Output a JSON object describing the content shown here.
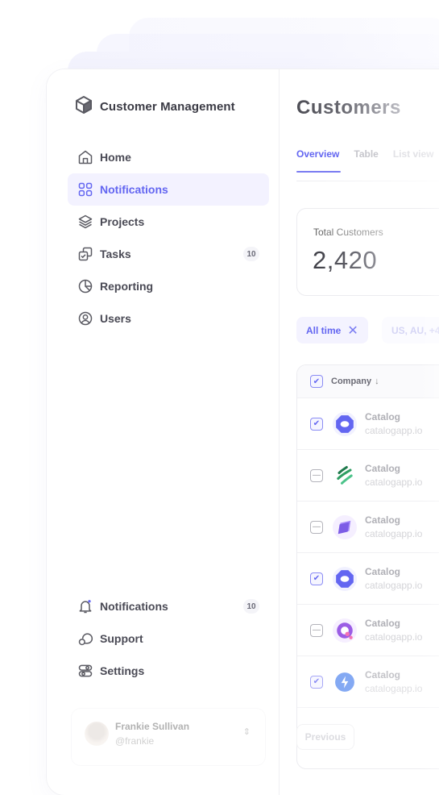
{
  "app": {
    "title": "Customer Management",
    "logo_icon": "cube-icon"
  },
  "sidebar": {
    "items": [
      {
        "label": "Home",
        "icon": "home-icon",
        "active": false
      },
      {
        "label": "Notifications",
        "icon": "grid-icon",
        "active": true
      },
      {
        "label": "Projects",
        "icon": "layers-icon",
        "active": false
      },
      {
        "label": "Tasks",
        "icon": "tasks-icon",
        "active": false,
        "badge": "10"
      },
      {
        "label": "Reporting",
        "icon": "pie-chart-icon",
        "active": false
      },
      {
        "label": "Users",
        "icon": "user-circle-icon",
        "active": false
      }
    ],
    "bottom_items": [
      {
        "label": "Notifications",
        "icon": "bell-icon",
        "badge": "10"
      },
      {
        "label": "Support",
        "icon": "support-icon"
      },
      {
        "label": "Settings",
        "icon": "settings-toggle-icon"
      }
    ],
    "user": {
      "name": "Frankie Sullivan",
      "handle": "@frankie",
      "chevron": "chevron-up-down-icon"
    }
  },
  "main": {
    "title": "Customers",
    "tabs": [
      {
        "label": "Overview",
        "active": true
      },
      {
        "label": "Table",
        "active": false
      },
      {
        "label": "List view",
        "active": false
      }
    ],
    "stat": {
      "label": "Total Customers",
      "value": "2,420"
    },
    "filters": [
      {
        "label": "All time",
        "removable": true
      },
      {
        "label": "US, AU, +4",
        "removable": false
      }
    ],
    "table": {
      "header": {
        "label": "Company",
        "sort": "↓",
        "checked": true
      },
      "rows": [
        {
          "name": "Catalog",
          "domain": "catalogapp.io",
          "checked": true,
          "logo": "octagon-logo",
          "color": "#6366f1"
        },
        {
          "name": "Catalog",
          "domain": "catalogapp.io",
          "checked": false,
          "logo": "waves-logo",
          "color": "#22a06b"
        },
        {
          "name": "Catalog",
          "domain": "catalogapp.io",
          "checked": false,
          "logo": "layers-logo",
          "color": "#8b5cf6"
        },
        {
          "name": "Catalog",
          "domain": "catalogapp.io",
          "checked": true,
          "logo": "octagon-logo",
          "color": "#6366f1"
        },
        {
          "name": "Catalog",
          "domain": "catalogapp.io",
          "checked": false,
          "logo": "q-logo",
          "color": "#a855f7"
        },
        {
          "name": "Catalog",
          "domain": "catalogapp.io",
          "checked": true,
          "logo": "bolt-logo",
          "color": "#5b8def"
        }
      ]
    },
    "pagination": {
      "previous_label": "Previous"
    }
  }
}
